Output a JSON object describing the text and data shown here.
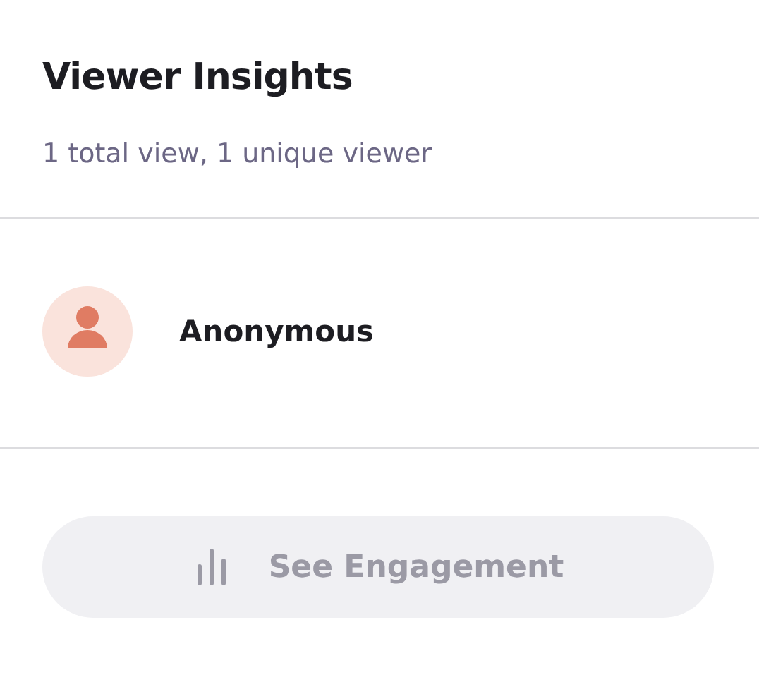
{
  "header": {
    "title": "Viewer Insights",
    "subtitle": "1 total view, 1 unique viewer"
  },
  "viewers": [
    {
      "name": "Anonymous"
    }
  ],
  "engagement_button": {
    "label": "See Engagement",
    "disabled": true
  }
}
